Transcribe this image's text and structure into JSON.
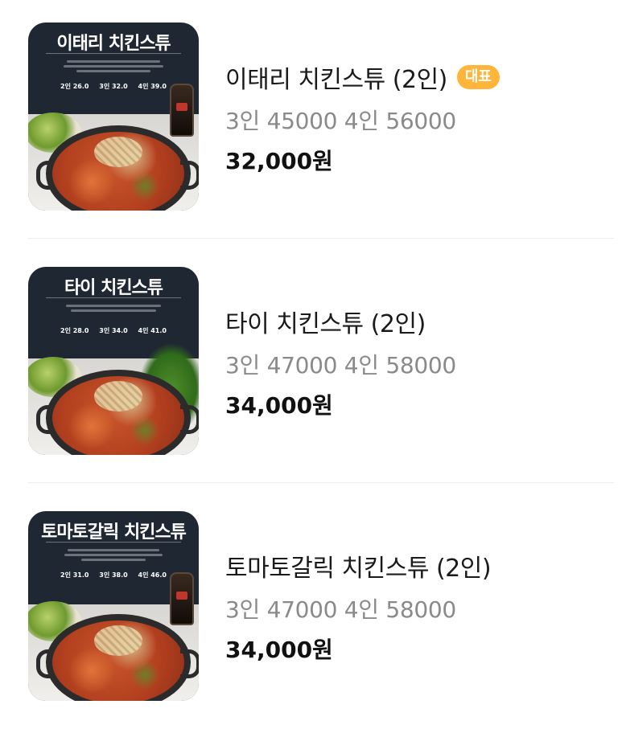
{
  "menu": {
    "items": [
      {
        "thumb_title": "이태리 치킨스튜",
        "thumb_prices": [
          "2인 26.0",
          "3인 32.0",
          "4인 39.0"
        ],
        "name": "이태리 치킨스튜 (2인)",
        "badge": "대표",
        "description": "3인 45000 4인 56000",
        "price": "32,000원"
      },
      {
        "thumb_title": "타이 치킨스튜",
        "thumb_prices": [
          "2인 28.0",
          "3인 34.0",
          "4인 41.0"
        ],
        "name": "타이 치킨스튜 (2인)",
        "description": "3인 47000 4인 58000",
        "price": "34,000원"
      },
      {
        "thumb_title": "토마토갈릭 치킨스튜",
        "thumb_prices": [
          "2인 31.0",
          "3인 38.0",
          "4인 46.0"
        ],
        "name": "토마토갈릭 치킨스튜 (2인)",
        "description": "3인 47000 4인 58000",
        "price": "34,000원"
      }
    ]
  },
  "colors": {
    "badge": "#ffb53a",
    "price": "#111111",
    "description": "#8a8a8a",
    "thumb_background": "#1f2733"
  }
}
